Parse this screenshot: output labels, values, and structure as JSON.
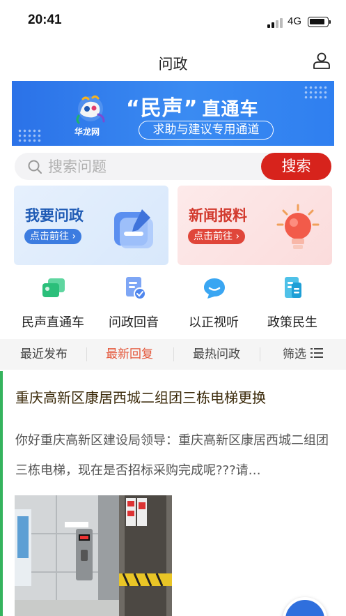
{
  "status": {
    "time": "20:41",
    "network": "4G"
  },
  "nav": {
    "title": "问政"
  },
  "banner": {
    "brand": "华龙网",
    "title_quoted": "“民声”",
    "title_suffix": "直通车",
    "subtitle": "求助与建议专用通道"
  },
  "search": {
    "placeholder": "搜索问题",
    "value": "",
    "button_label": "搜索"
  },
  "cards": [
    {
      "title": "我要问政",
      "action": "点击前往 ›"
    },
    {
      "title": "新闻报料",
      "action": "点击前往 ›"
    }
  ],
  "shortcuts": [
    {
      "label": "民声直通车",
      "icon": "chat-bubbles-icon"
    },
    {
      "label": "问政回音",
      "icon": "document-check-icon"
    },
    {
      "label": "以正视听",
      "icon": "message-bubble-icon"
    },
    {
      "label": "政策民生",
      "icon": "policy-document-icon"
    }
  ],
  "tabs": [
    {
      "label": "最近发布",
      "active": false
    },
    {
      "label": "最新回复",
      "active": true
    },
    {
      "label": "最热问政",
      "active": false
    },
    {
      "label": "筛选",
      "active": false
    }
  ],
  "post": {
    "title": "重庆高新区康居西城二组团三栋电梯更换",
    "body": "你好重庆高新区建设局领导：重庆高新区康居西城二组团三栋电梯，现在是否招标采购完成呢???请…"
  },
  "colors": {
    "accent_red": "#d7231c",
    "tab_active": "#e4573a",
    "post_accent": "#35b35d",
    "banner_blue": "#2f7ff0"
  }
}
